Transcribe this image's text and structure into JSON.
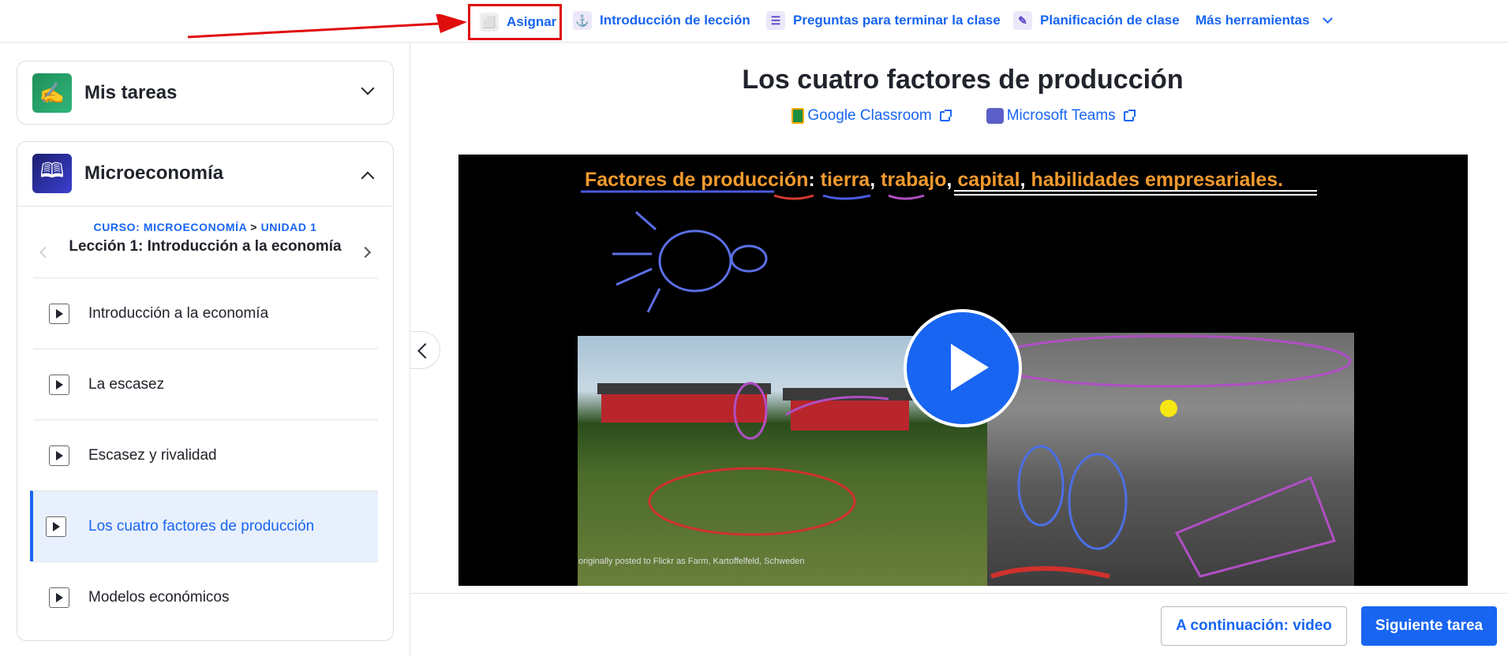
{
  "toolbar": {
    "items": [
      {
        "label": "Asignar",
        "icon": "assign-icon"
      },
      {
        "label": "Introducción de lección",
        "icon": "anchor-icon"
      },
      {
        "label": "Preguntas para terminar la clase",
        "icon": "ticket-icon"
      },
      {
        "label": "Planificación de clase",
        "icon": "pencil-icon"
      },
      {
        "label": "Más herramientas",
        "icon": "chevron-down-icon"
      }
    ]
  },
  "sidebar": {
    "tasks_card": {
      "title": "Mis tareas"
    },
    "course_card": {
      "title": "Microeconomía",
      "breadcrumb_course": "CURSO: MICROECONOMÍA",
      "breadcrumb_sep": ">",
      "breadcrumb_unit": "UNIDAD 1",
      "lesson_title": "Lección 1: Introducción a la economía",
      "items": [
        {
          "label": "Introducción a la economía"
        },
        {
          "label": "La escasez"
        },
        {
          "label": "Escasez y rivalidad"
        },
        {
          "label": "Los cuatro factores de producción"
        },
        {
          "label": "Modelos económicos"
        }
      ]
    }
  },
  "main": {
    "title": "Los cuatro factores de producción",
    "share": {
      "google": "Google Classroom",
      "teams": "Microsoft Teams"
    },
    "video": {
      "title_prefix": "Factores de producción",
      "title_colon": ":",
      "word1": "tierra",
      "word2": "trabajo",
      "word3": "capital",
      "word4": "habilidades empresariales.",
      "caption": "originally posted to Flickr as Farm, Kartoffelfeld, Schweden"
    }
  },
  "footer": {
    "next_label": "A continuación: video",
    "next_task_label": "Siguiente tarea"
  },
  "colors": {
    "accent": "#1865f2",
    "highlight_border": "#e00d0d",
    "video_title": "#f19a2e"
  }
}
